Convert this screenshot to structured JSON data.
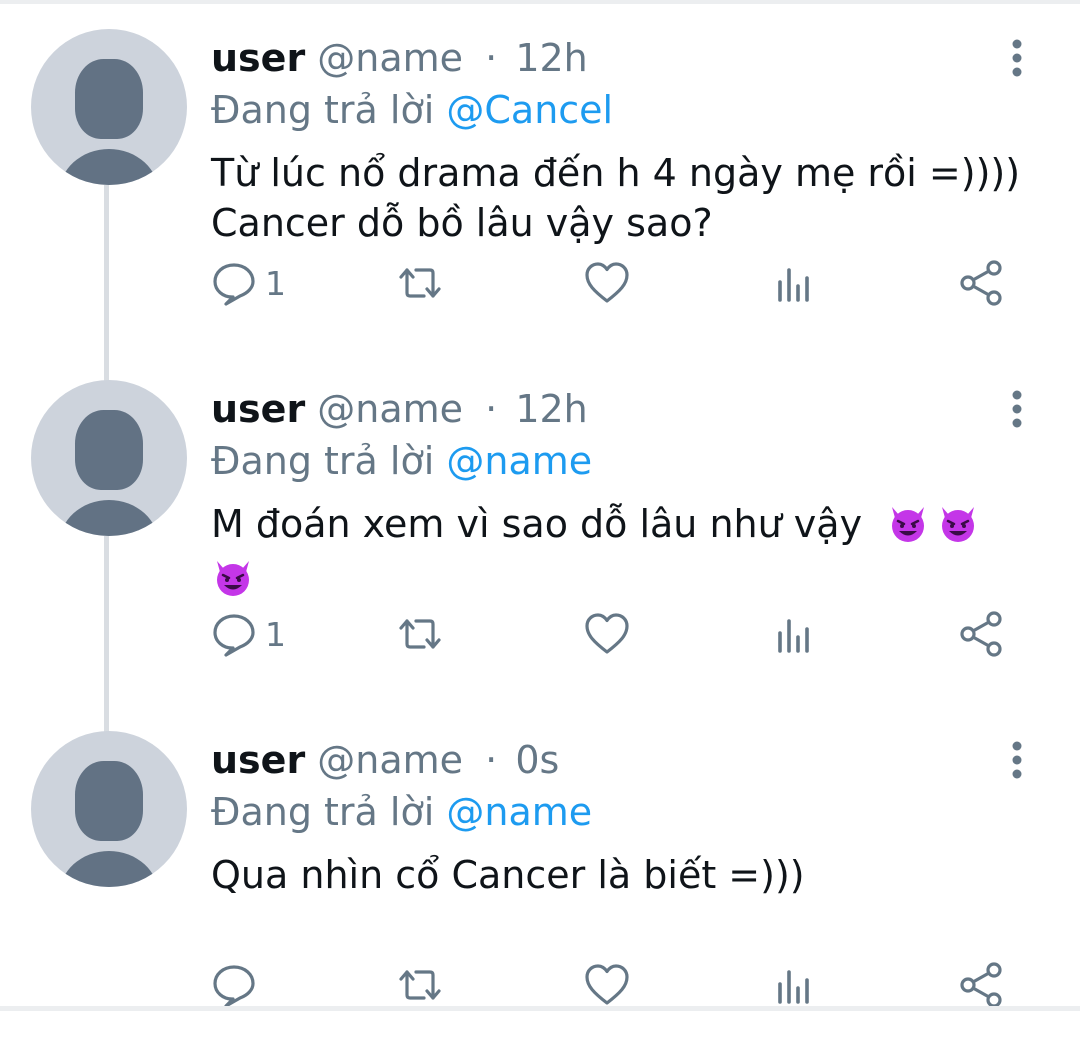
{
  "tweets": [
    {
      "username": "user",
      "handle": "@name",
      "separator": "·",
      "time": "12h",
      "reply_prefix": "Đang trả lời",
      "reply_target": "@Cancel",
      "text_lines": [
        "Từ lúc nổ drama đến h 4 ngày mẹ rồi =))))",
        "Cancer dỗ bồ lâu vậy sao?"
      ],
      "reply_count": "1"
    },
    {
      "username": "user",
      "handle": "@name",
      "separator": "·",
      "time": "12h",
      "reply_prefix": "Đang trả lời",
      "reply_target": "@name",
      "text_lines": [
        "M đoán xem vì sao dỗ lâu như vậy"
      ],
      "emojis": [
        "smiling-devil-emoji",
        "smiling-devil-emoji",
        "smiling-devil-emoji"
      ],
      "reply_count": "1"
    },
    {
      "username": "user",
      "handle": "@name",
      "separator": "·",
      "time": "0s",
      "reply_prefix": "Đang trả lời",
      "reply_target": "@name",
      "text_lines": [
        "Qua nhìn cổ Cancer là biết =)))"
      ],
      "reply_count": ""
    }
  ],
  "icons": {
    "reply": "reply-icon",
    "retweet": "retweet-icon",
    "like": "like-icon",
    "analytics": "analytics-icon",
    "share": "share-icon",
    "more": "more-options-icon"
  },
  "colors": {
    "username": "#0f1419",
    "secondary": "#657786",
    "link": "#1d9bf0",
    "avatar_bg": "#cdd3dc",
    "avatar_fg": "#627284",
    "thread_line": "#d9dde2",
    "emoji": "#c436e8"
  }
}
